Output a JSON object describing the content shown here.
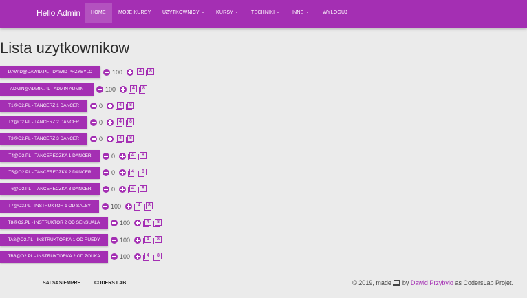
{
  "nav": {
    "brand": "Hello Admin",
    "items": [
      {
        "label": "HOME"
      },
      {
        "label": "MOJE KURSY"
      },
      {
        "label": "UZYTKOWNICY"
      },
      {
        "label": "KURSY"
      },
      {
        "label": "TECHNIKI"
      },
      {
        "label": "INNE"
      },
      {
        "label": "WYLOGUJ"
      }
    ]
  },
  "page": {
    "title": "Lista uzytkownikow"
  },
  "colors": {
    "accent": "#a42fb3",
    "background": "#ebebeb"
  },
  "users": [
    {
      "label": "DAWID@DAWID.PL - DAWID PRZYBYLO",
      "score": "100",
      "icon_a": "4",
      "icon_b": "8"
    },
    {
      "label": "ADMIN@ADMIN.PL - ADMIN ADMIN",
      "score": "100",
      "icon_a": "4",
      "icon_b": "8"
    },
    {
      "label": "T1@O2.PL - TANCERZ 1 DANCER",
      "score": "0",
      "icon_a": "4",
      "icon_b": "8"
    },
    {
      "label": "T2@O2.PL - TANCERZ 2 DANCER",
      "score": "0",
      "icon_a": "4",
      "icon_b": "8"
    },
    {
      "label": "T3@O2.PL - TANCERZ 3 DANCER",
      "score": "0",
      "icon_a": "4",
      "icon_b": "8"
    },
    {
      "label": "T4@O2.PL - TANCERECZKA 1 DANCER",
      "score": "0",
      "icon_a": "4",
      "icon_b": "8"
    },
    {
      "label": "T5@O2.PL - TANCERECZKA 2 DANCER",
      "score": "0",
      "icon_a": "4",
      "icon_b": "8"
    },
    {
      "label": "T6@O2.PL - TANCERECZKA 3 DANCER",
      "score": "0",
      "icon_a": "4",
      "icon_b": "8"
    },
    {
      "label": "T7@O2.PL - INSTRUKTOR 1 OD SALSY",
      "score": "100",
      "icon_a": "4",
      "icon_b": "8"
    },
    {
      "label": "T8@O2.PL - INSTRUKTOR 2 OD SENSUALA",
      "score": "100",
      "icon_a": "4",
      "icon_b": "8"
    },
    {
      "label": "TA8@O2.PL - INSTRUKTORKA 1 OD RUEDY",
      "score": "100",
      "icon_a": "4",
      "icon_b": "8"
    },
    {
      "label": "TB8@O2.PL - INSTRUKTORKA 2 OD ZOUKA",
      "score": "100",
      "icon_a": "4",
      "icon_b": "8"
    }
  ],
  "footer": {
    "link1": "SALSASIEMPRE",
    "link2": "CODERS LAB",
    "copyright_prefix": "© 2019, made",
    "by": "by",
    "author": "Dawid Przybylo",
    "suffix": "as CodersLab Projet."
  }
}
